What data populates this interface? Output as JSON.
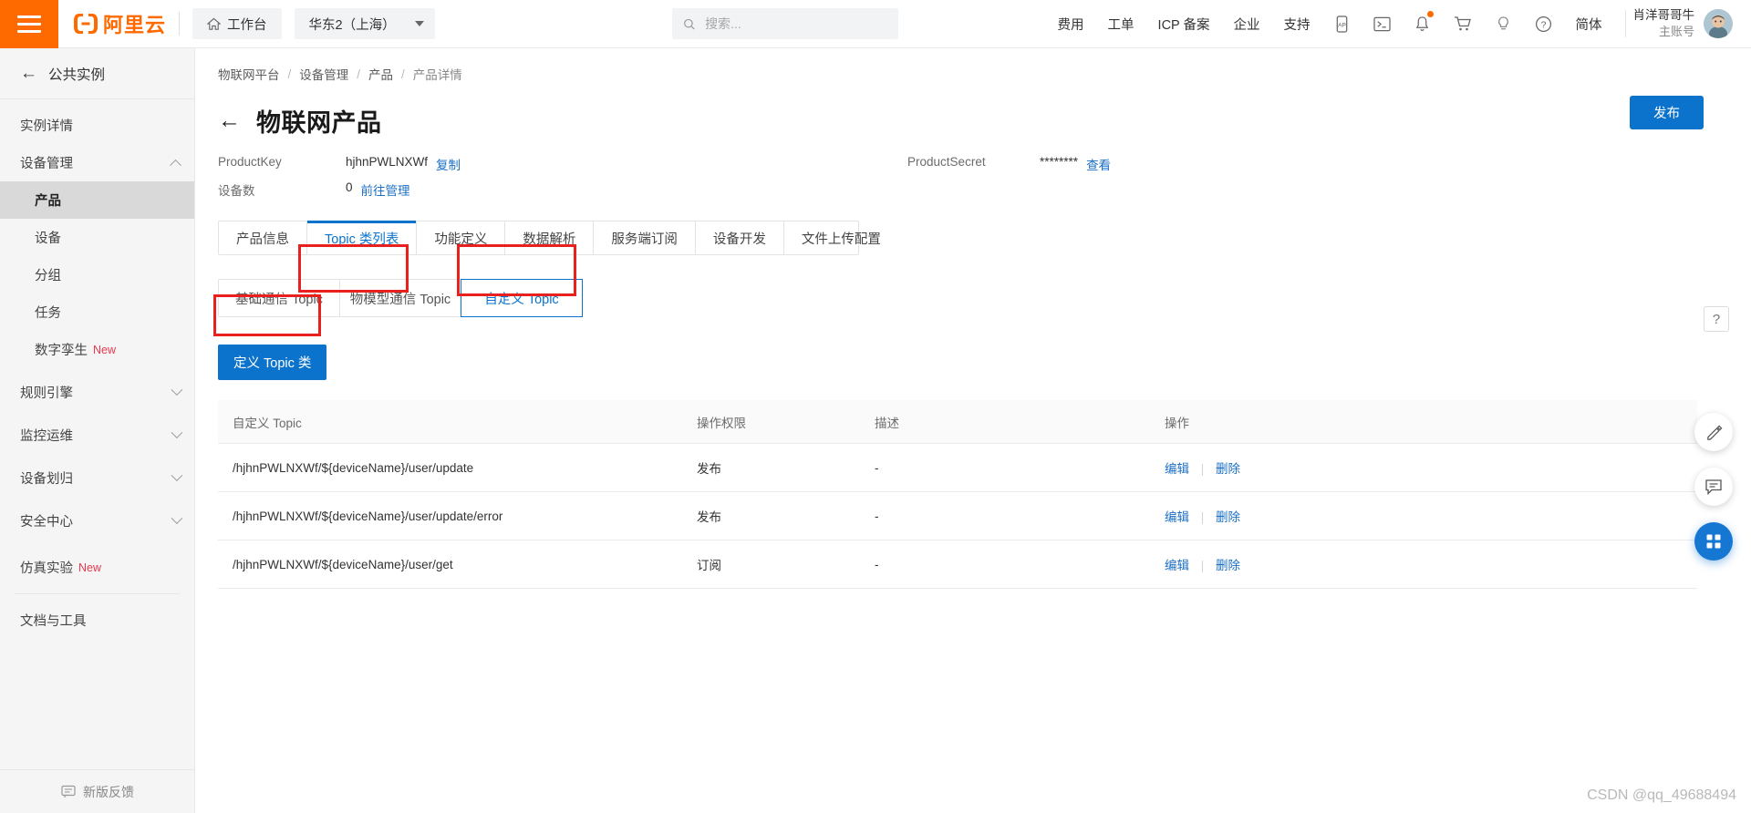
{
  "header": {
    "menu_icon": "hamburger-icon",
    "logo_text": "阿里云",
    "workbench_label": "工作台",
    "region_label": "华东2（上海）",
    "search_placeholder": "搜索...",
    "search_value": "",
    "links": [
      "费用",
      "工单",
      "ICP 备案",
      "企业",
      "支持"
    ],
    "icons": [
      "app-icon",
      "terminal-icon",
      "bell-icon",
      "cart-icon",
      "bulb-icon",
      "question-icon"
    ],
    "language_label": "简体",
    "user_name": "肖洋哥哥牛",
    "user_role": "主账号",
    "notification_badge": true
  },
  "sidebar": {
    "back_label": "公共实例",
    "items": [
      {
        "label": "实例详情",
        "level": 0,
        "active": false,
        "expandable": false,
        "badge": ""
      },
      {
        "label": "设备管理",
        "level": 0,
        "active": false,
        "expandable": true,
        "expanded": true,
        "badge": ""
      },
      {
        "label": "产品",
        "level": 1,
        "active": true,
        "expandable": false,
        "badge": ""
      },
      {
        "label": "设备",
        "level": 1,
        "active": false,
        "expandable": false,
        "badge": ""
      },
      {
        "label": "分组",
        "level": 1,
        "active": false,
        "expandable": false,
        "badge": ""
      },
      {
        "label": "任务",
        "level": 1,
        "active": false,
        "expandable": false,
        "badge": ""
      },
      {
        "label": "数字孪生",
        "level": 1,
        "active": false,
        "expandable": false,
        "badge": "New"
      },
      {
        "label": "规则引擎",
        "level": 0,
        "active": false,
        "expandable": true,
        "expanded": false,
        "badge": ""
      },
      {
        "label": "监控运维",
        "level": 0,
        "active": false,
        "expandable": true,
        "expanded": false,
        "badge": ""
      },
      {
        "label": "设备划归",
        "level": 0,
        "active": false,
        "expandable": true,
        "expanded": false,
        "badge": ""
      },
      {
        "label": "安全中心",
        "level": 0,
        "active": false,
        "expandable": true,
        "expanded": false,
        "badge": ""
      },
      {
        "label": "仿真实验",
        "level": 0,
        "active": false,
        "expandable": false,
        "badge": "New"
      }
    ],
    "docs_label": "文档与工具",
    "feedback_label": "新版反馈"
  },
  "breadcrumb": [
    "物联网平台",
    "设备管理",
    "产品",
    "产品详情"
  ],
  "page": {
    "title": "物联网产品",
    "publish_button": "发布",
    "product_key_label": "ProductKey",
    "product_key_value": "hjhnPWLNXWf",
    "copy_label": "复制",
    "product_secret_label": "ProductSecret",
    "product_secret_value": "********",
    "view_label": "查看",
    "device_count_label": "设备数",
    "device_count_value": "0",
    "goto_manage_label": "前往管理"
  },
  "tabs": [
    {
      "label": "产品信息",
      "active": false
    },
    {
      "label": "Topic 类列表",
      "active": true
    },
    {
      "label": "功能定义",
      "active": false
    },
    {
      "label": "数据解析",
      "active": false
    },
    {
      "label": "服务端订阅",
      "active": false
    },
    {
      "label": "设备开发",
      "active": false
    },
    {
      "label": "文件上传配置",
      "active": false
    }
  ],
  "subtabs": [
    {
      "label": "基础通信 Topic",
      "active": false
    },
    {
      "label": "物模型通信 Topic",
      "active": false
    },
    {
      "label": "自定义 Topic",
      "active": true
    }
  ],
  "define_button": "定义 Topic 类",
  "help_icon": "question-mark-icon",
  "table": {
    "columns": [
      "自定义 Topic",
      "操作权限",
      "描述",
      "操作"
    ],
    "rows": [
      {
        "topic": "/hjhnPWLNXWf/${deviceName}/user/update",
        "permission": "发布",
        "description": "-",
        "edit": "编辑",
        "delete": "删除"
      },
      {
        "topic": "/hjhnPWLNXWf/${deviceName}/user/update/error",
        "permission": "发布",
        "description": "-",
        "edit": "编辑",
        "delete": "删除"
      },
      {
        "topic": "/hjhnPWLNXWf/${deviceName}/user/get",
        "permission": "订阅",
        "description": "-",
        "edit": "编辑",
        "delete": "删除"
      }
    ]
  },
  "float_buttons": [
    {
      "name": "pencil-icon"
    },
    {
      "name": "chat-icon"
    },
    {
      "name": "apps-grid-icon"
    }
  ],
  "watermark": "CSDN @qq_49688494",
  "colors": {
    "brand_orange": "#ff6a00",
    "link_blue": "#1b6fc4",
    "primary_blue": "#0b73cc",
    "highlight_red": "#e8201e",
    "new_badge_red": "#e8384f"
  }
}
